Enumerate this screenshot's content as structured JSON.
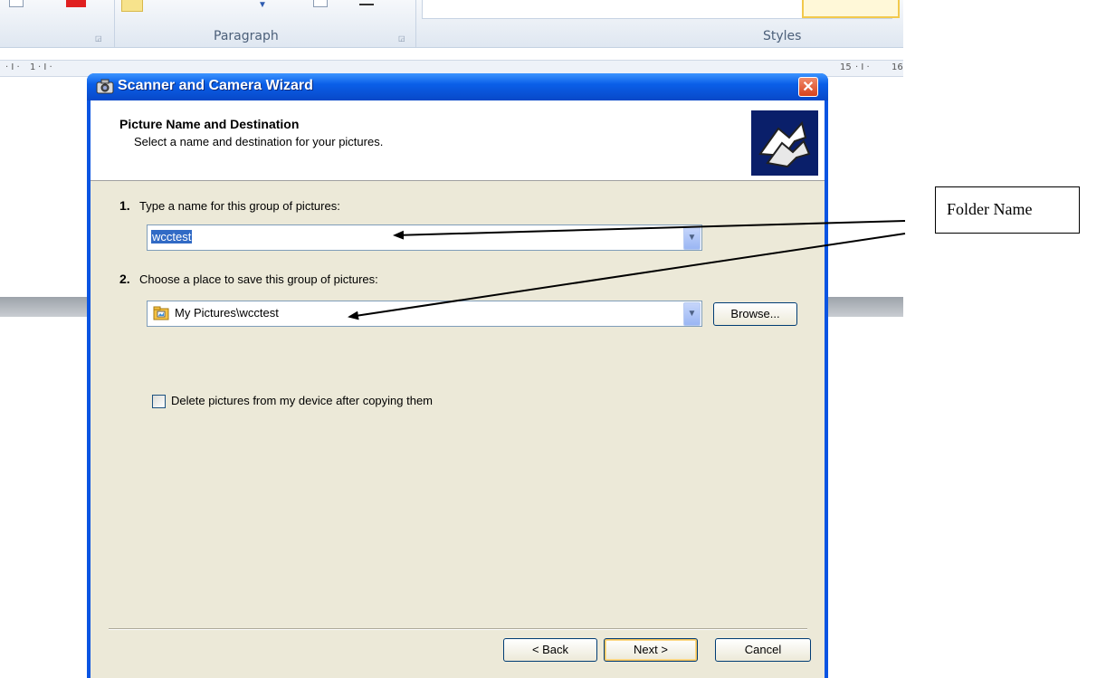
{
  "ribbon": {
    "groups": [
      {
        "label": "Paragraph"
      },
      {
        "label": "Styles"
      }
    ]
  },
  "ruler": {
    "ticks": [
      "1",
      "15",
      "16"
    ]
  },
  "dialog": {
    "title": "Scanner and Camera Wizard",
    "close_label": "✕",
    "header_title": "Picture Name and Destination",
    "header_subtitle": "Select a name and destination for your pictures.",
    "step1": {
      "number": "1.",
      "label": "Type a name for this group of pictures:",
      "value": "wcctest"
    },
    "step2": {
      "number": "2.",
      "label": "Choose a place to save this group of pictures:",
      "value": "My Pictures\\wcctest",
      "browse_label": "Browse..."
    },
    "delete_checkbox": {
      "label": "Delete pictures from my device after copying them",
      "checked": false
    },
    "buttons": {
      "back": "< Back",
      "next": "Next >",
      "cancel": "Cancel"
    }
  },
  "callout": {
    "label": "Folder Name"
  }
}
